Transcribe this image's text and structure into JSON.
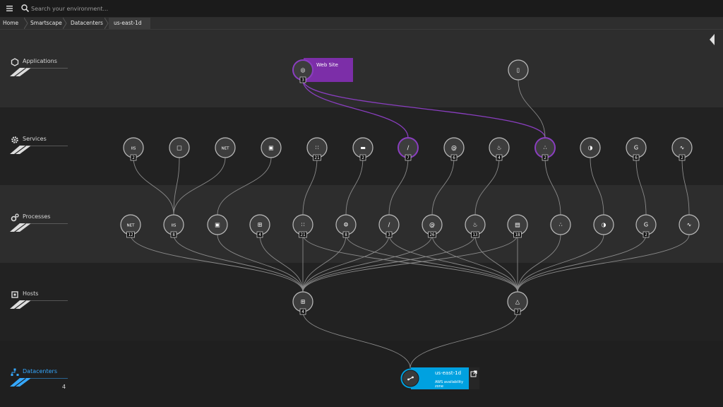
{
  "search": {
    "placeholder": "Search your environment..."
  },
  "breadcrumb": [
    "Home",
    "Smartscape",
    "Datacenters",
    "us-east-1d"
  ],
  "layers": [
    {
      "name": "Applications",
      "icon": "hexagon-icon"
    },
    {
      "name": "Services",
      "icon": "gear-icon"
    },
    {
      "name": "Processes",
      "icon": "process-gears-icon"
    },
    {
      "name": "Hosts",
      "icon": "host-chip-icon"
    },
    {
      "name": "Datacenters",
      "icon": "datacenter-tree-icon",
      "count": "4"
    }
  ],
  "colors": {
    "accent_blue": "#00a1e0",
    "app_purple": "#7c2ea8",
    "link": "#8a8a8a",
    "selected_link": "#8a3ec0"
  },
  "applications": [
    {
      "id": "a1",
      "icon": "globe-icon",
      "glyph": "◎",
      "badge": "3",
      "label": "Web Site",
      "selected": true
    },
    {
      "id": "a2",
      "icon": "mobile-app-icon",
      "glyph": "▯",
      "badge": ""
    }
  ],
  "services": [
    {
      "id": "s1",
      "icon": "iis-icon",
      "glyph": "IIS",
      "badge": "2"
    },
    {
      "id": "s2",
      "icon": "database-icon",
      "glyph": "□",
      "badge": ""
    },
    {
      "id": "s3",
      "icon": "dotnet-icon",
      "glyph": "NET",
      "badge": ""
    },
    {
      "id": "s4",
      "icon": "image-service-icon",
      "glyph": "▣",
      "badge": ""
    },
    {
      "id": "s5",
      "icon": "cluster-icon",
      "glyph": "∷",
      "badge": "21"
    },
    {
      "id": "s6",
      "icon": "message-queue-icon",
      "glyph": "▬",
      "badge": "2"
    },
    {
      "id": "s7",
      "icon": "feather-icon",
      "glyph": "∕",
      "badge": "7",
      "selected": true
    },
    {
      "id": "s8",
      "icon": "at-icon",
      "glyph": "@",
      "badge": "6"
    },
    {
      "id": "s9",
      "icon": "java-icon",
      "glyph": "♨",
      "badge": "4"
    },
    {
      "id": "s10",
      "icon": "nodes-icon",
      "glyph": "∴",
      "badge": "2",
      "selected": true
    },
    {
      "id": "s11",
      "icon": "half-moon-icon",
      "glyph": "◑",
      "badge": ""
    },
    {
      "id": "s12",
      "icon": "golang-icon",
      "glyph": "G",
      "badge": "6"
    },
    {
      "id": "s13",
      "icon": "wave-icon",
      "glyph": "∿",
      "badge": "2"
    }
  ],
  "processes": [
    {
      "id": "p1",
      "icon": "dotnet-icon",
      "glyph": "NET",
      "badge": "12"
    },
    {
      "id": "p2",
      "icon": "iis-icon",
      "glyph": "IIS",
      "badge": "8"
    },
    {
      "id": "p3",
      "icon": "image-service-icon",
      "glyph": "▣",
      "badge": ""
    },
    {
      "id": "p4",
      "icon": "windows-icon",
      "glyph": "⊞",
      "badge": "4"
    },
    {
      "id": "p5",
      "icon": "cluster-icon",
      "glyph": "∷",
      "badge": "21"
    },
    {
      "id": "p6",
      "icon": "gear-icon",
      "glyph": "⚙",
      "badge": "8"
    },
    {
      "id": "p7",
      "icon": "feather-icon",
      "glyph": "∕",
      "badge": "3"
    },
    {
      "id": "p8",
      "icon": "at-icon",
      "glyph": "@",
      "badge": "26"
    },
    {
      "id": "p9",
      "icon": "java-icon",
      "glyph": "♨",
      "badge": "13"
    },
    {
      "id": "p10",
      "icon": "boxes-icon",
      "glyph": "▤",
      "badge": "18"
    },
    {
      "id": "p11",
      "icon": "nodes-icon",
      "glyph": "∴",
      "badge": ""
    },
    {
      "id": "p12",
      "icon": "half-moon-icon",
      "glyph": "◑",
      "badge": ""
    },
    {
      "id": "p13",
      "icon": "golang-icon",
      "glyph": "G",
      "badge": "2"
    },
    {
      "id": "p14",
      "icon": "wave-icon",
      "glyph": "∿",
      "badge": ""
    }
  ],
  "hosts": [
    {
      "id": "h1",
      "icon": "windows-icon",
      "glyph": "⊞",
      "badge": "4"
    },
    {
      "id": "h2",
      "icon": "linux-icon",
      "glyph": "△",
      "badge": "7"
    }
  ],
  "datacenter": {
    "icon": "datacenter-pin-icon",
    "name": "us-east-1d",
    "subtitle": "AWS availability zone"
  }
}
